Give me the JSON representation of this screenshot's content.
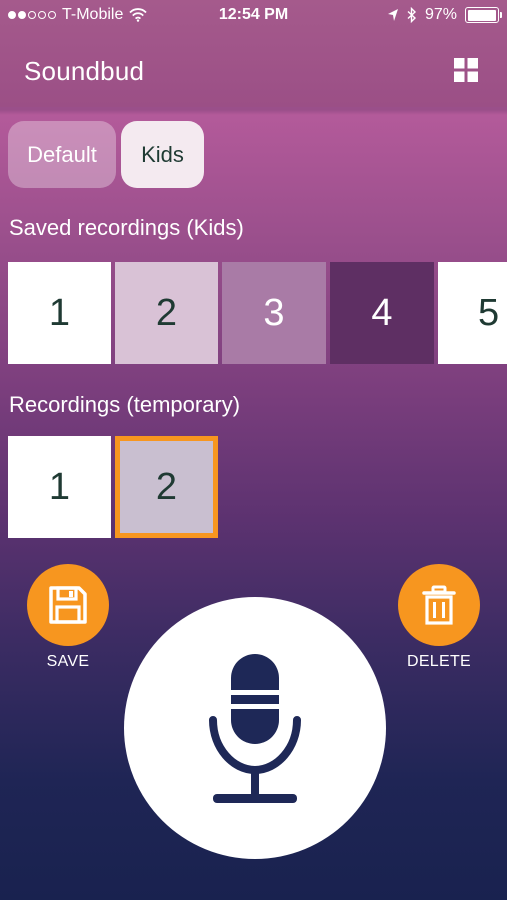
{
  "status_bar": {
    "signal_strength": 2,
    "signal_max": 5,
    "carrier": "T-Mobile",
    "time": "12:54 PM",
    "battery_percent": "97%",
    "battery_level": 0.97,
    "icons": [
      "wifi-icon",
      "location-icon",
      "bluetooth-icon",
      "battery-icon"
    ]
  },
  "nav": {
    "title": "Soundbud",
    "grid_icon": "grid-icon"
  },
  "profiles": {
    "tabs": [
      {
        "label": "Default",
        "selected": false
      },
      {
        "label": "Kids",
        "selected": true
      }
    ]
  },
  "saved_recordings": {
    "label": "Saved recordings (Kids)",
    "items": [
      {
        "label": "1",
        "color": "#ffffff",
        "text_color": "#1f3a33"
      },
      {
        "label": "2",
        "color": "#d9c2d6",
        "text_color": "#1f3a33"
      },
      {
        "label": "3",
        "color": "#a97ba6",
        "text_color": "#ffffff"
      },
      {
        "label": "4",
        "color": "#5e2f63",
        "text_color": "#ffffff"
      },
      {
        "label": "5",
        "color": "#ffffff",
        "text_color": "#1f3a33"
      }
    ]
  },
  "temporary_recordings": {
    "label": "Recordings (temporary)",
    "items": [
      {
        "label": "1",
        "color": "#ffffff",
        "text_color": "#1f3a33",
        "selected": false
      },
      {
        "label": "2",
        "color": "#c9bfd0",
        "text_color": "#1f3a33",
        "selected": true
      }
    ]
  },
  "actions": {
    "save": {
      "label": "SAVE",
      "icon": "floppy-disk-icon"
    },
    "delete": {
      "label": "DELETE",
      "icon": "trash-icon"
    },
    "record": {
      "icon": "microphone-icon"
    }
  },
  "colors": {
    "accent": "#f7961f",
    "dark_text": "#1f3a33",
    "mic_icon": "#1e2857"
  }
}
